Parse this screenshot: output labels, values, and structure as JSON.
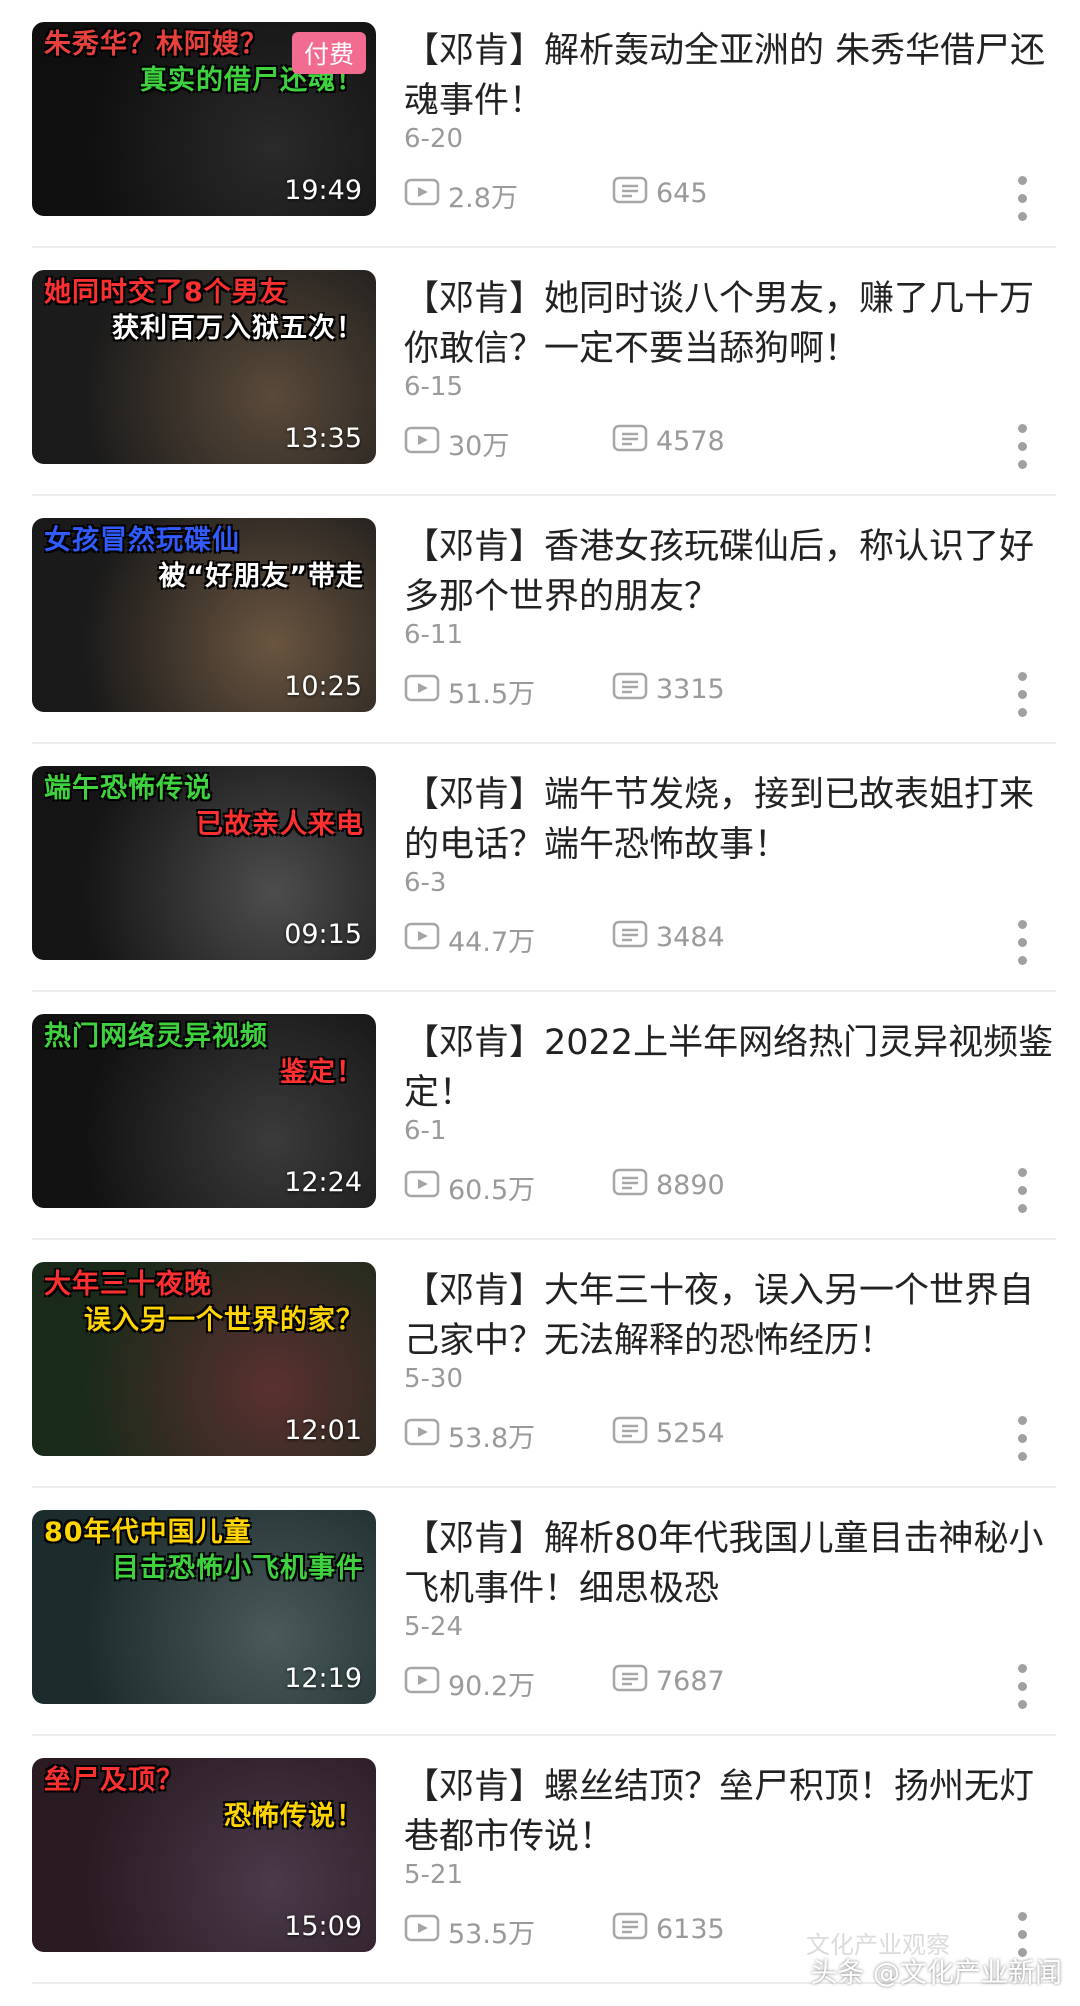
{
  "videos": [
    {
      "title": "【邓肯】解析轰动全亚洲的 朱秀华借尸还魂事件！",
      "date": "6-20",
      "plays": "2.8万",
      "comments": "645",
      "duration": "19:49",
      "paid_badge": "付费",
      "thumb_caption": [
        "朱秀华？林阿嫂？",
        "真实的借尸还魂！"
      ],
      "thumb_colors": [
        "#0f0f0f",
        "#2a2a2a",
        "#e8413d",
        "#3fd23f"
      ]
    },
    {
      "title": "【邓肯】她同时谈八个男友，赚了几十万你敢信？一定不要当舔狗啊！",
      "date": "6-15",
      "plays": "30万",
      "comments": "4578",
      "duration": "13:35",
      "thumb_caption": [
        "她同时交了8个男友",
        "获利百万入狱五次！"
      ],
      "thumb_colors": [
        "#1b1b1b",
        "#5a4a3a",
        "#ff3030",
        "#ffffff"
      ]
    },
    {
      "title": "【邓肯】香港女孩玩碟仙后，称认识了好多那个世界的朋友？",
      "date": "6-11",
      "plays": "51.5万",
      "comments": "3315",
      "duration": "10:25",
      "thumb_caption": [
        "女孩冒然玩碟仙",
        "被“好朋友”带走"
      ],
      "thumb_colors": [
        "#1a1a1a",
        "#6a5540",
        "#2f5bff",
        "#ffffff"
      ]
    },
    {
      "title": "【邓肯】端午节发烧，接到已故表姐打来的电话？端午恐怖故事！",
      "date": "6-3",
      "plays": "44.7万",
      "comments": "3484",
      "duration": "09:15",
      "thumb_caption": [
        "端午恐怖传说",
        "已故亲人来电"
      ],
      "thumb_colors": [
        "#151515",
        "#4d4d4d",
        "#3fd23f",
        "#ff3030"
      ]
    },
    {
      "title": "【邓肯】2022上半年网络热门灵异视频鉴定！",
      "date": "6-1",
      "plays": "60.5万",
      "comments": "8890",
      "duration": "12:24",
      "thumb_caption": [
        "热门网络灵异视频",
        "鉴定！"
      ],
      "thumb_colors": [
        "#121212",
        "#3b3b3b",
        "#3fd23f",
        "#ff3030"
      ]
    },
    {
      "title": "【邓肯】大年三十夜，误入另一个世界自己家中？无法解释的恐怖经历！",
      "date": "5-30",
      "plays": "53.8万",
      "comments": "5254",
      "duration": "12:01",
      "thumb_caption": [
        "大年三十夜晚",
        "误入另一个世界的家？"
      ],
      "thumb_colors": [
        "#1a2a1a",
        "#5a3030",
        "#ff3030",
        "#ffd400"
      ]
    },
    {
      "title": "【邓肯】解析80年代我国儿童目击神秘小飞机事件！细思极恐",
      "date": "5-24",
      "plays": "90.2万",
      "comments": "7687",
      "duration": "12:19",
      "thumb_caption": [
        "80年代中国儿童",
        "目击恐怖小飞机事件"
      ],
      "thumb_colors": [
        "#1c2c2c",
        "#4a5a5a",
        "#ffd400",
        "#3fd23f"
      ]
    },
    {
      "title": "【邓肯】螺丝结顶？垒尸积顶！扬州无灯巷都市传说！",
      "date": "5-21",
      "plays": "53.5万",
      "comments": "6135",
      "duration": "15:09",
      "thumb_caption": [
        "垒尸及顶？",
        "恐怖传说！"
      ],
      "thumb_colors": [
        "#2a1a22",
        "#4a3a4a",
        "#ff3030",
        "#ffd400"
      ]
    }
  ],
  "watermark": {
    "text": "头条 @文化产业新闻",
    "ghost": "文化产业观察"
  },
  "icons": {
    "play": "play-count-icon",
    "comment": "comment-count-icon",
    "more": "more-options-icon"
  }
}
